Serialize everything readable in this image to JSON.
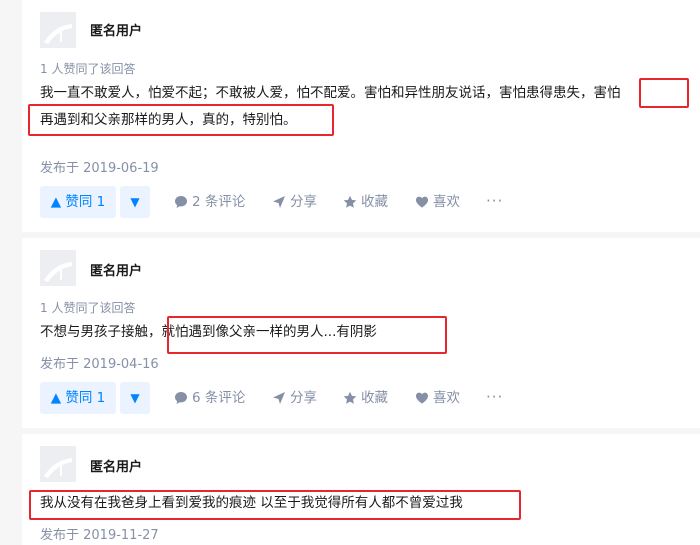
{
  "answers": [
    {
      "username": "匿名用户",
      "votes_text": "1 人赞同了该回答",
      "content_line1": "我一直不敢爱人，怕爱不起；不敢被人爱，怕不配爱。害怕和异性朋友说话，害怕患得患失，害怕",
      "content_line2": "再遇到和父亲那样的男人，真的，特别怕。",
      "date": "发布于 2019-06-19",
      "upvote_label": "▲ 赞同 1",
      "comments_label": "2 条评论",
      "share_label": "分享",
      "collect_label": "收藏",
      "like_label": "喜欢",
      "more_label": "···"
    },
    {
      "username": "匿名用户",
      "votes_text": "1 人赞同了该回答",
      "content_line1": "不想与男孩子接触，就怕遇到像父亲一样的男人...有阴影",
      "date": "发布于 2019-04-16",
      "upvote_label": "▲ 赞同 1",
      "comments_label": "6 条评论",
      "share_label": "分享",
      "collect_label": "收藏",
      "like_label": "喜欢",
      "more_label": "···"
    },
    {
      "username": "匿名用户",
      "content_line1": "我从没有在我爸身上看到爱我的痕迹 以至于我觉得所有人都不曾爱过我",
      "date": "发布于 2019-11-27"
    }
  ],
  "downvote_symbol": "▼",
  "colors": {
    "accent": "#0084ff",
    "accent_bg": "#eaf3ff",
    "muted": "#8590a6",
    "highlight": "#e8262d"
  }
}
